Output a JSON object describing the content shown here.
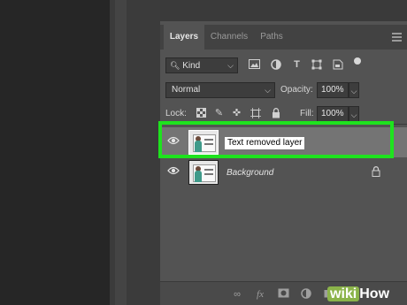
{
  "panel": {
    "tabs": [
      {
        "label": "Layers",
        "active": true
      },
      {
        "label": "Channels",
        "active": false
      },
      {
        "label": "Paths",
        "active": false
      }
    ],
    "filter": {
      "kind_label": "Kind",
      "icons": [
        "image-filter-icon",
        "adjustment-filter-icon",
        "type-filter-icon",
        "shape-filter-icon",
        "smart-object-filter-icon"
      ]
    },
    "blend": {
      "mode": "Normal",
      "opacity_label": "Opacity:",
      "opacity_value": "100%",
      "lock_label": "Lock:",
      "fill_label": "Fill:",
      "fill_value": "100%"
    },
    "layers": [
      {
        "name": "Text removed layer",
        "editing": true,
        "selected": true,
        "visible": true
      },
      {
        "name": "Background",
        "editing": false,
        "selected": false,
        "visible": true,
        "locked": true
      }
    ],
    "bottom_icons": [
      "link-icon",
      "fx-icon",
      "mask-icon",
      "adjustment-icon",
      "folder-icon"
    ]
  },
  "watermark": {
    "part1": "wiki",
    "part2": "How"
  },
  "colors": {
    "highlight": "#1ee31e",
    "panel_bg": "#535353",
    "selected_row": "#747474"
  }
}
